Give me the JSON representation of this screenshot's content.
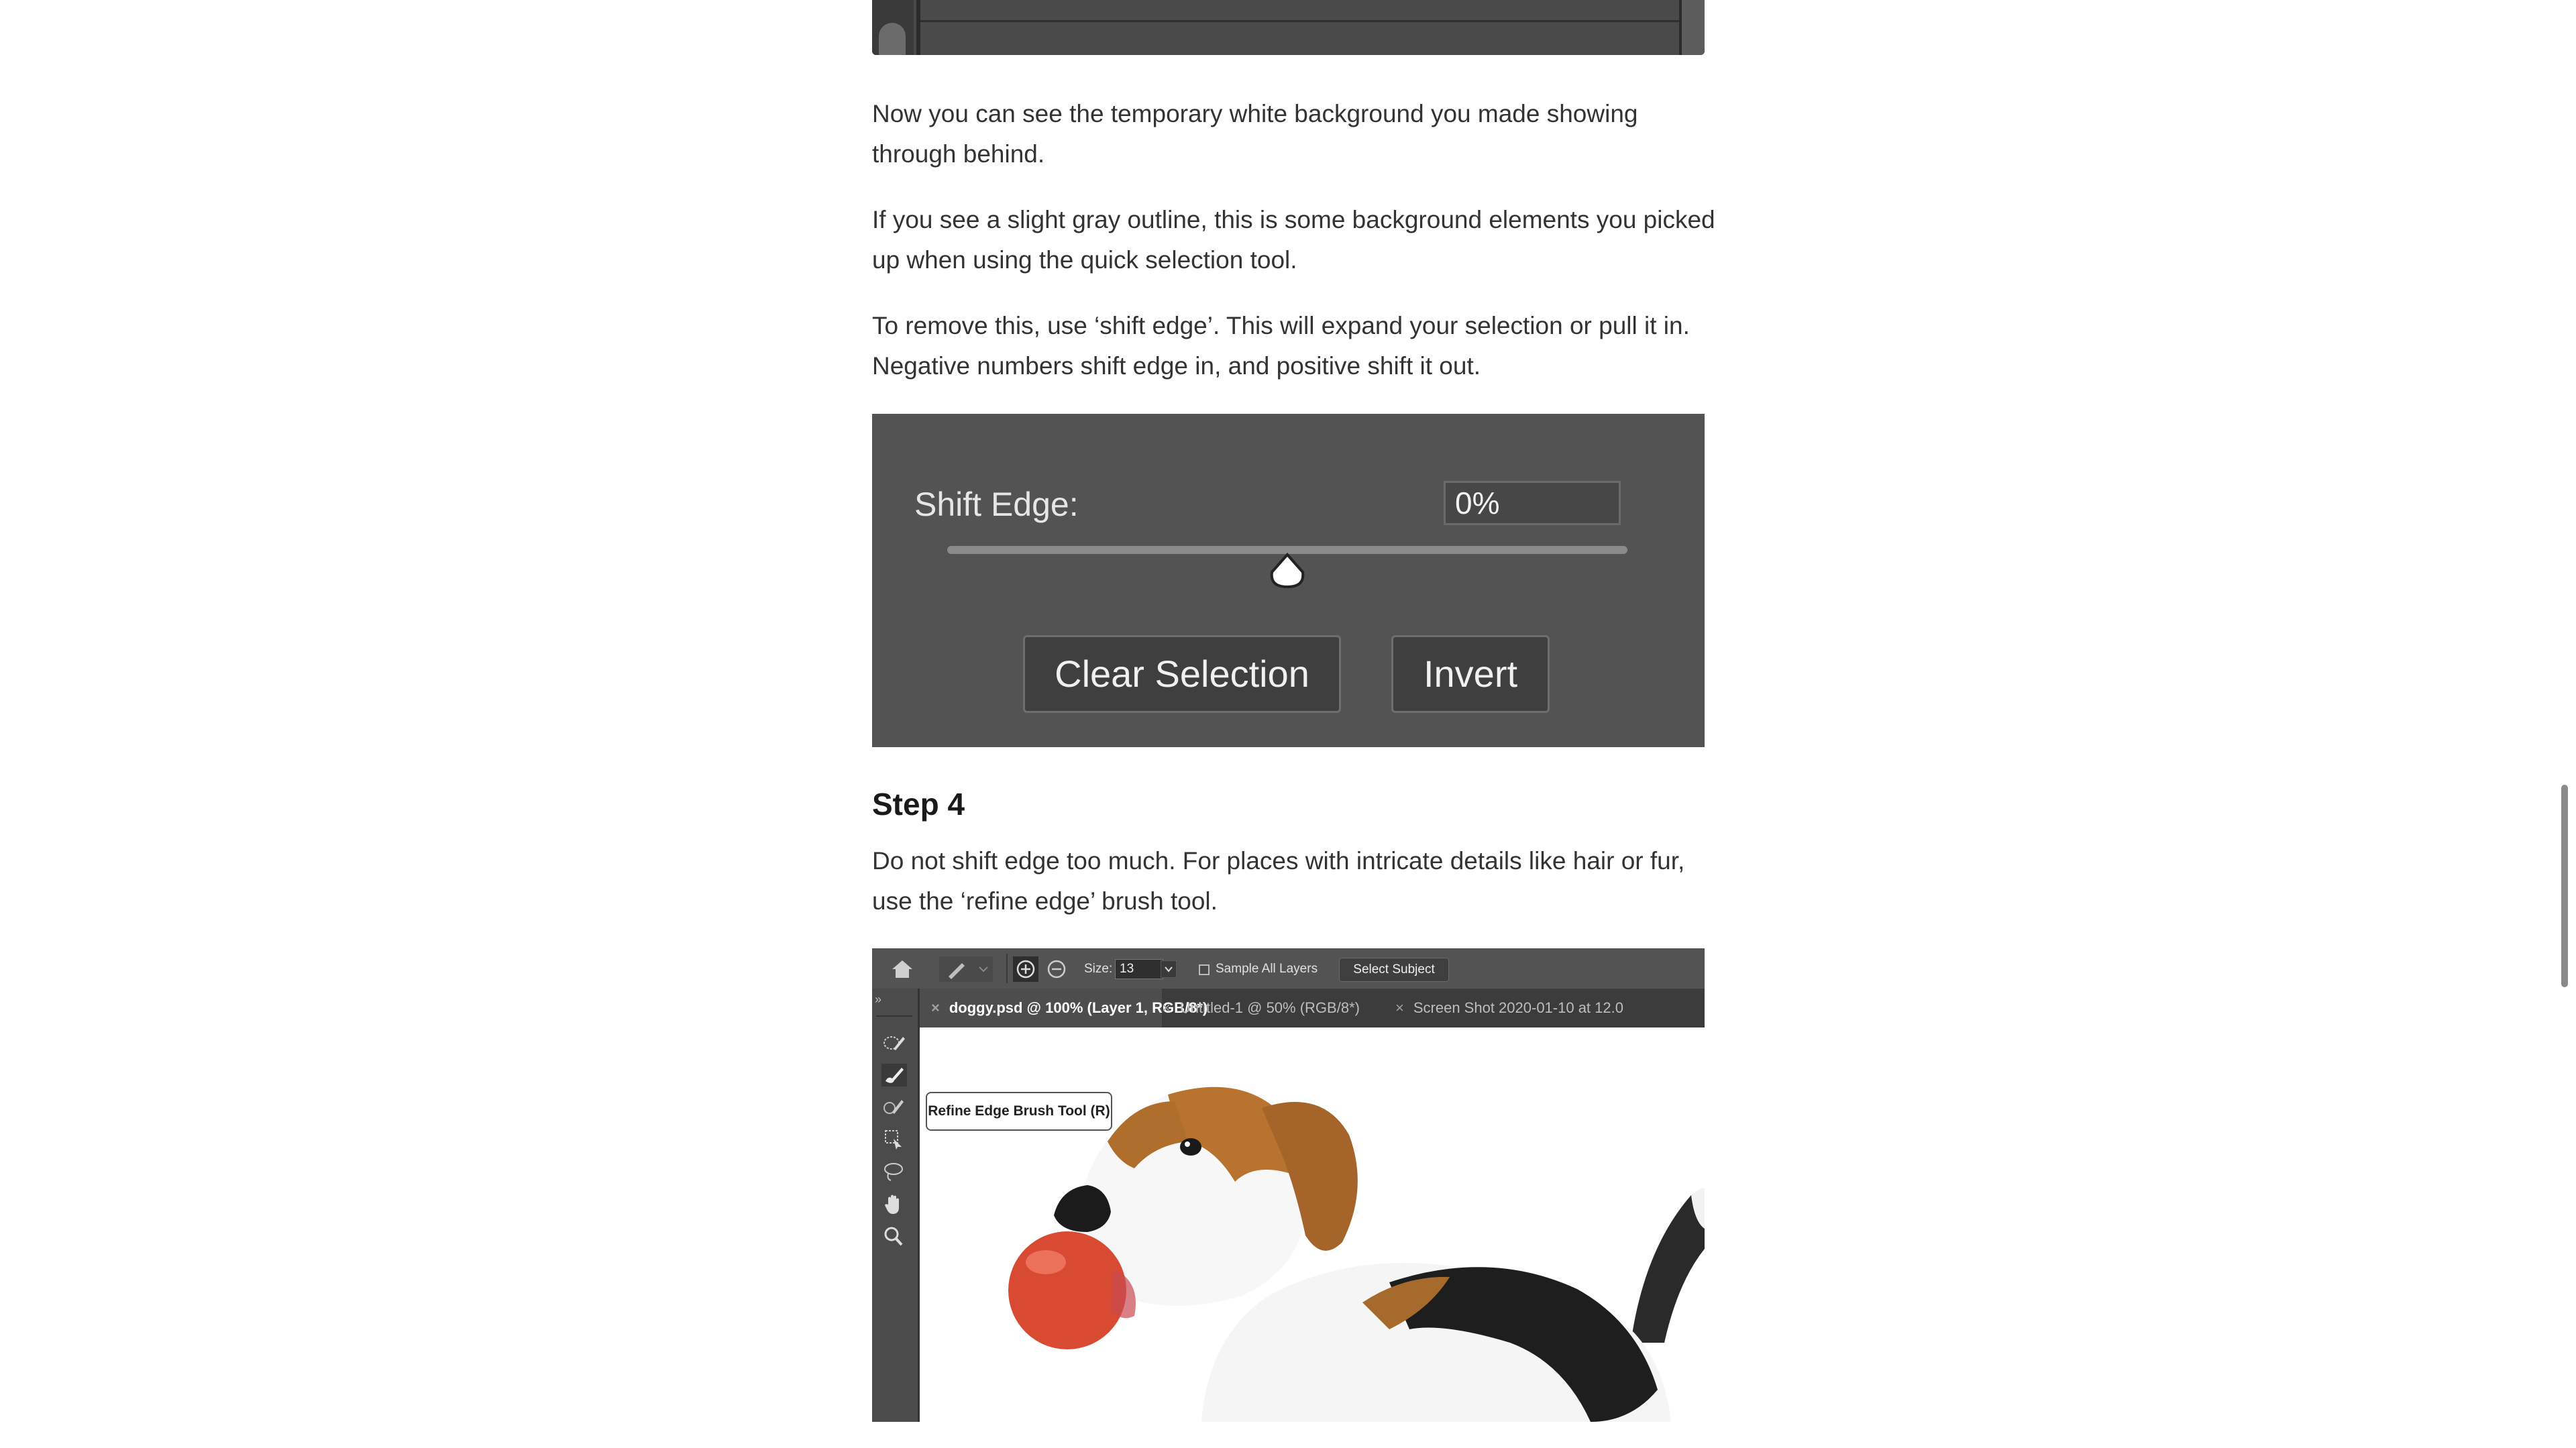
{
  "article": {
    "paragraphs": [
      "Now you can see the temporary white background you made showing through behind.",
      "If you see a slight gray outline, this is some background elements you picked up when using the quick selection tool.",
      "To remove this, use ‘shift edge’. This will expand your selection or pull it in. Negative numbers shift edge in, and positive shift it out."
    ],
    "step_heading": "Step 4",
    "step_paragraph": "Do not shift edge too much. For places with intricate details like hair or fur, use the ‘refine edge’ brush tool."
  },
  "shift_edge_panel": {
    "label": "Shift Edge:",
    "value": "0%",
    "slider_fraction": 0.5,
    "clear_selection_label": "Clear Selection",
    "invert_label": "Invert"
  },
  "photoshop": {
    "options_bar": {
      "size_label": "Size:",
      "size_value": "13",
      "sample_all_layers_label": "Sample All Layers",
      "sample_all_layers_checked": false,
      "select_subject_label": "Select Subject"
    },
    "tabs": [
      {
        "close": "×",
        "label": "doggy.psd @ 100% (Layer 1, RGB/8*)",
        "active": true
      },
      {
        "close": "×",
        "label": "Untitled-1 @ 50% (RGB/8*)",
        "active": false
      },
      {
        "close": "×",
        "label": "Screen Shot 2020-01-10 at 12.0",
        "active": false
      }
    ],
    "tools": [
      "quick-selection-icon",
      "refine-edge-brush-icon",
      "brush-icon",
      "object-selection-icon",
      "lasso-icon",
      "hand-icon",
      "zoom-icon"
    ],
    "tooltip": "Refine Edge Brush Tool (R)",
    "expand_arrows": "»"
  },
  "colors": {
    "panel_bg": "#535353",
    "ps_chrome": "#3c3c3c",
    "text": "#333333"
  }
}
